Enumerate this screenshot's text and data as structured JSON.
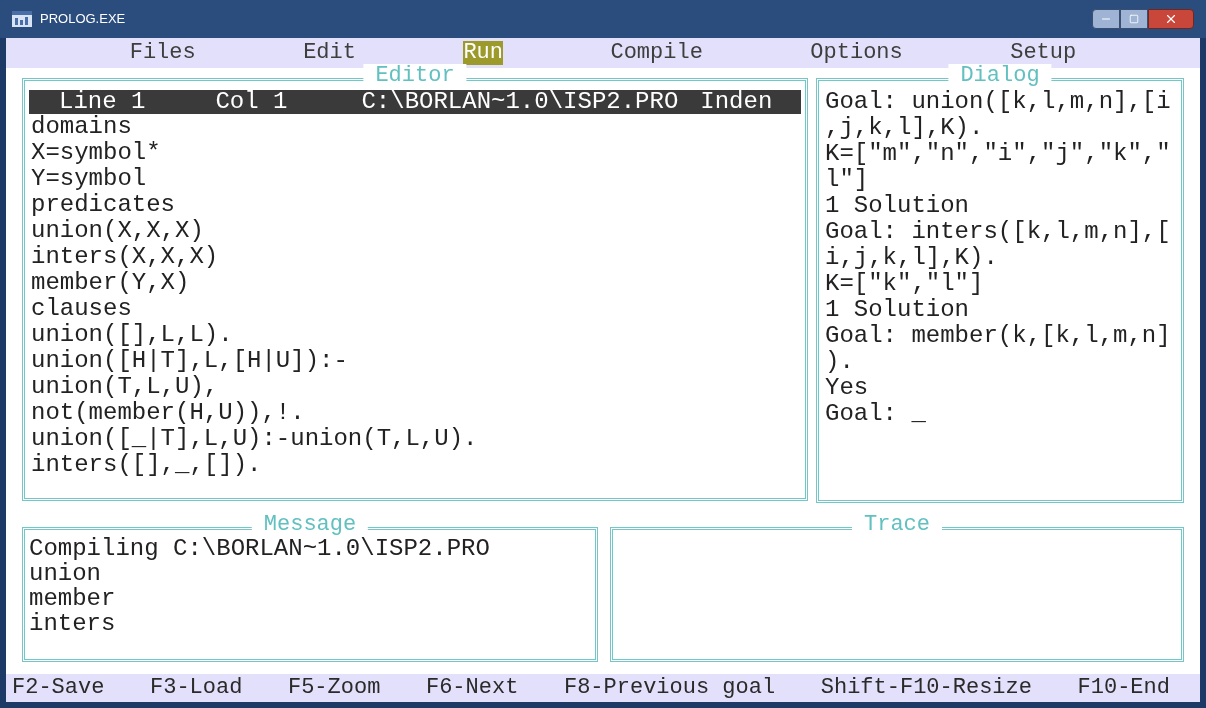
{
  "window": {
    "title": "PROLOG.EXE"
  },
  "menu": [
    {
      "label": "Files",
      "selected": false
    },
    {
      "label": "Edit",
      "selected": false
    },
    {
      "label": "Run",
      "selected": true
    },
    {
      "label": "Compile",
      "selected": false
    },
    {
      "label": "Options",
      "selected": false
    },
    {
      "label": "Setup",
      "selected": false
    }
  ],
  "editor": {
    "title": "Editor",
    "status": [
      "Line 1",
      "Col 1",
      "C:\\BORLAN~1.0\\ISP2.PRO",
      "Inden"
    ],
    "lines": [
      "domains",
      "X=symbol*",
      "Y=symbol",
      "predicates",
      "union(X,X,X)",
      "inters(X,X,X)",
      "member(Y,X)",
      "clauses",
      "union([],L,L).",
      "union([H|T],L,[H|U]):-",
      "union(T,L,U),",
      "not(member(H,U)),!.",
      "union([_|T],L,U):-union(T,L,U).",
      "inters([],_,[])."
    ]
  },
  "dialog": {
    "title": "Dialog",
    "lines": [
      "Goal: union([k,l,m,n],[i",
      ",j,k,l],K).",
      "K=[\"m\",\"n\",\"i\",\"j\",\"k\",\"",
      "l\"]",
      "1 Solution",
      "Goal: inters([k,l,m,n],[",
      "i,j,k,l],K).",
      "K=[\"k\",\"l\"]",
      "1 Solution",
      "Goal: member(k,[k,l,m,n]",
      ").",
      "Yes",
      "Goal: _"
    ]
  },
  "message": {
    "title": "Message",
    "lines": [
      "Compiling C:\\BORLAN~1.0\\ISP2.PRO",
      "union",
      "member",
      "inters"
    ]
  },
  "trace": {
    "title": "Trace"
  },
  "function_keys": [
    "F2-Save",
    "F3-Load",
    "F5-Zoom",
    "F6-Next",
    "F8-Previous goal",
    "Shift-F10-Resize",
    "F10-End"
  ]
}
